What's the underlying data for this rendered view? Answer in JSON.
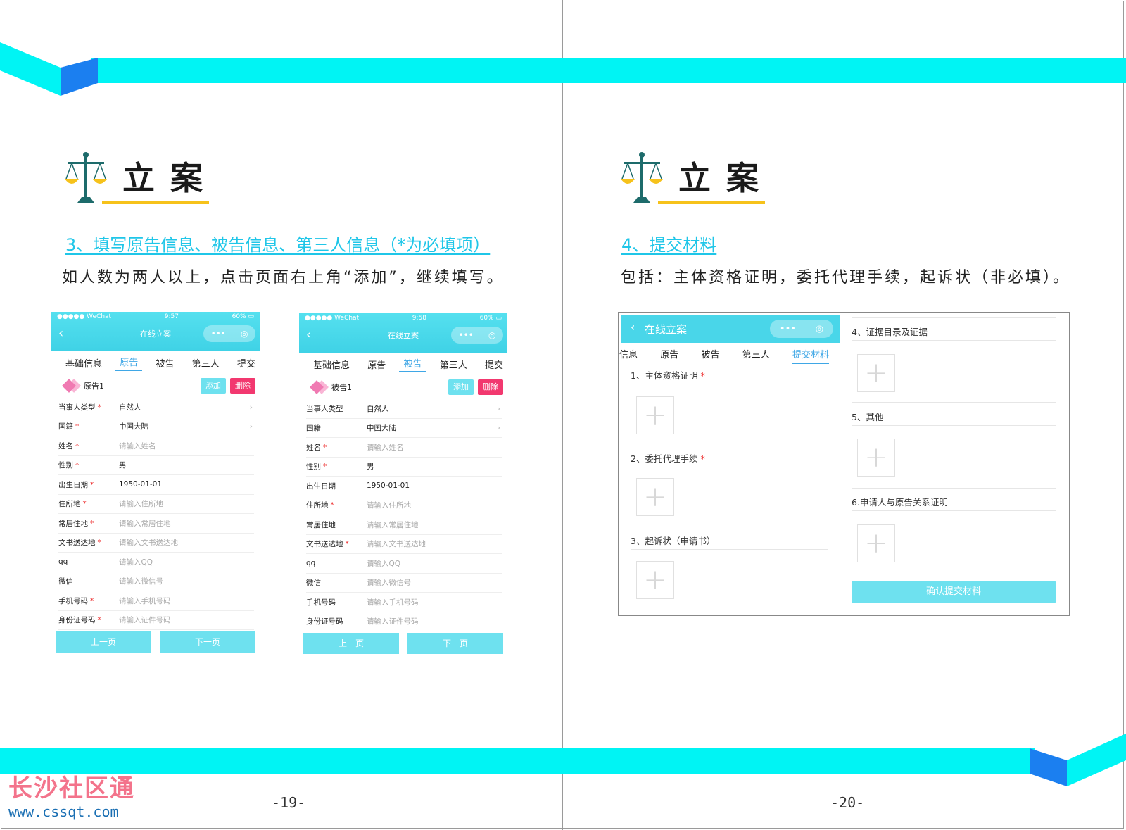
{
  "colors": {
    "accent_cyan": "#00f4f4",
    "accent_blue": "#1b7ff0",
    "title_underline": "#f6c21b",
    "subhead": "#1fc6e8",
    "wechat_bar": "#49d6e9",
    "button": "#6ee1ef",
    "delete": "#f2386f",
    "required": "#e33333"
  },
  "left_page": {
    "title": "立案",
    "subhead": "3、填写原告信息、被告信息、第三人信息（*为必填项）",
    "body": "如人数为两人以上，点击页面右上角“添加”，继续填写。",
    "page_number": "-19-"
  },
  "right_page": {
    "title": "立案",
    "subhead": "4、提交材料",
    "body": "包括：主体资格证明，委托代理手续，起诉状（非必填）。",
    "page_number": "-20-"
  },
  "phones": [
    {
      "status_left": "●●●●● WeChat",
      "time": "9:57",
      "battery": "60%",
      "nav_title": "在线立案",
      "tabs": [
        "基础信息",
        "原告",
        "被告",
        "第三人",
        "提交"
      ],
      "active_tab": "原告",
      "party": "原告1",
      "add": "添加",
      "del": "删除",
      "fields": [
        {
          "label": "当事人类型",
          "req": "*",
          "value": "自然人",
          "ph": false,
          "chev": "›"
        },
        {
          "label": "国籍",
          "req": "*",
          "value": "中国大陆",
          "ph": false,
          "chev": "›"
        },
        {
          "label": "姓名",
          "req": "*",
          "value": "请输入姓名",
          "ph": true,
          "chev": ""
        },
        {
          "label": "性别",
          "req": "*",
          "value": "男",
          "ph": false,
          "chev": ""
        },
        {
          "label": "出生日期",
          "req": "*",
          "value": "1950-01-01",
          "ph": false,
          "chev": ""
        },
        {
          "label": "住所地",
          "req": "*",
          "value": "请输入住所地",
          "ph": true,
          "chev": ""
        },
        {
          "label": "常居住地",
          "req": "*",
          "value": "请输入常居住地",
          "ph": true,
          "chev": ""
        },
        {
          "label": "文书送达地",
          "req": "*",
          "value": "请输入文书送达地",
          "ph": true,
          "chev": ""
        },
        {
          "label": "qq",
          "req": "",
          "value": "请输入QQ",
          "ph": true,
          "chev": ""
        },
        {
          "label": "微信",
          "req": "",
          "value": "请输入微信号",
          "ph": true,
          "chev": ""
        },
        {
          "label": "手机号码",
          "req": "*",
          "value": "请输入手机号码",
          "ph": true,
          "chev": ""
        },
        {
          "label": "身份证号码",
          "req": "*",
          "value": "请输入证件号码",
          "ph": true,
          "chev": ""
        }
      ],
      "prev": "上一页",
      "next": "下一页"
    },
    {
      "status_left": "●●●●● WeChat",
      "time": "9:58",
      "battery": "60%",
      "nav_title": "在线立案",
      "tabs": [
        "基础信息",
        "原告",
        "被告",
        "第三人",
        "提交"
      ],
      "active_tab": "被告",
      "party": "被告1",
      "add": "添加",
      "del": "删除",
      "fields": [
        {
          "label": "当事人类型",
          "req": "",
          "value": "自然人",
          "ph": false,
          "chev": "›"
        },
        {
          "label": "国籍",
          "req": "",
          "value": "中国大陆",
          "ph": false,
          "chev": "›"
        },
        {
          "label": "姓名",
          "req": "*",
          "value": "请输入姓名",
          "ph": true,
          "chev": ""
        },
        {
          "label": "性别",
          "req": "*",
          "value": "男",
          "ph": false,
          "chev": ""
        },
        {
          "label": "出生日期",
          "req": "",
          "value": "1950-01-01",
          "ph": false,
          "chev": ""
        },
        {
          "label": "住所地",
          "req": "*",
          "value": "请输入住所地",
          "ph": true,
          "chev": ""
        },
        {
          "label": "常居住地",
          "req": "",
          "value": "请输入常居住地",
          "ph": true,
          "chev": ""
        },
        {
          "label": "文书送达地",
          "req": "*",
          "value": "请输入文书送达地",
          "ph": true,
          "chev": ""
        },
        {
          "label": "qq",
          "req": "",
          "value": "请输入QQ",
          "ph": true,
          "chev": ""
        },
        {
          "label": "微信",
          "req": "",
          "value": "请输入微信号",
          "ph": true,
          "chev": ""
        },
        {
          "label": "手机号码",
          "req": "",
          "value": "请输入手机号码",
          "ph": true,
          "chev": ""
        },
        {
          "label": "身份证号码",
          "req": "",
          "value": "请输入证件号码",
          "ph": true,
          "chev": ""
        }
      ],
      "prev": "上一页",
      "next": "下一页"
    }
  ],
  "materials": {
    "nav_title": "在线立案",
    "tabs": [
      "信息",
      "原告",
      "被告",
      "第三人",
      "提交材料"
    ],
    "active_tab": "提交材料",
    "sections": [
      {
        "label": "1、主体资格证明",
        "req": "*"
      },
      {
        "label": "2、委托代理手续",
        "req": "*"
      },
      {
        "label": "3、起诉状（申请书）",
        "req": ""
      },
      {
        "label": "4、证据目录及证据",
        "req": ""
      },
      {
        "label": "5、其他",
        "req": ""
      },
      {
        "label": "6.申请人与原告关系证明",
        "req": ""
      }
    ],
    "confirm": "确认提交材料"
  },
  "watermark": {
    "name": "长沙社区通",
    "url": "www.cssqt.com"
  }
}
